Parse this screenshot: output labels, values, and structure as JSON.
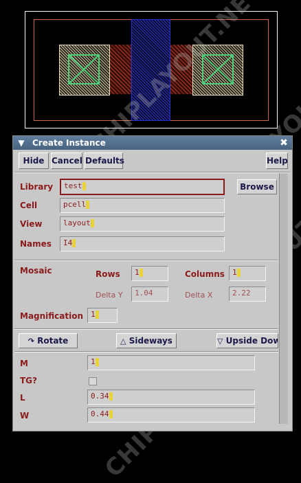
{
  "watermark": "CHIPLAYOUT.NET",
  "dialog": {
    "title": "Create Instance",
    "buttons": {
      "hide": "Hide",
      "cancel": "Cancel",
      "defaults": "Defaults",
      "help": "Help"
    },
    "library": {
      "label": "Library",
      "value": "test",
      "browse": "Browse"
    },
    "cell": {
      "label": "Cell",
      "value": "pcell"
    },
    "view": {
      "label": "View",
      "value": "layout"
    },
    "names": {
      "label": "Names",
      "value": "I4"
    },
    "mosaic": {
      "label": "Mosaic",
      "rows_label": "Rows",
      "rows_value": "1",
      "columns_label": "Columns",
      "columns_value": "1",
      "delta_y_label": "Delta Y",
      "delta_y_value": "1.04",
      "delta_x_label": "Delta X",
      "delta_x_value": "2.22"
    },
    "magnification": {
      "label": "Magnification",
      "value": "1"
    },
    "transforms": {
      "rotate": "Rotate",
      "sideways": "Sideways",
      "upside_down": "Upside Dow"
    },
    "params": {
      "m_label": "M",
      "m_value": "1",
      "tg_label": "TG?",
      "l_label": "L",
      "l_value": "0.34",
      "w_label": "W",
      "w_value": "0.44"
    }
  },
  "colors": {
    "titlebar": "#5f7e9d",
    "label": "#8b1b1b",
    "dialog_bg": "#c8c8c8"
  }
}
